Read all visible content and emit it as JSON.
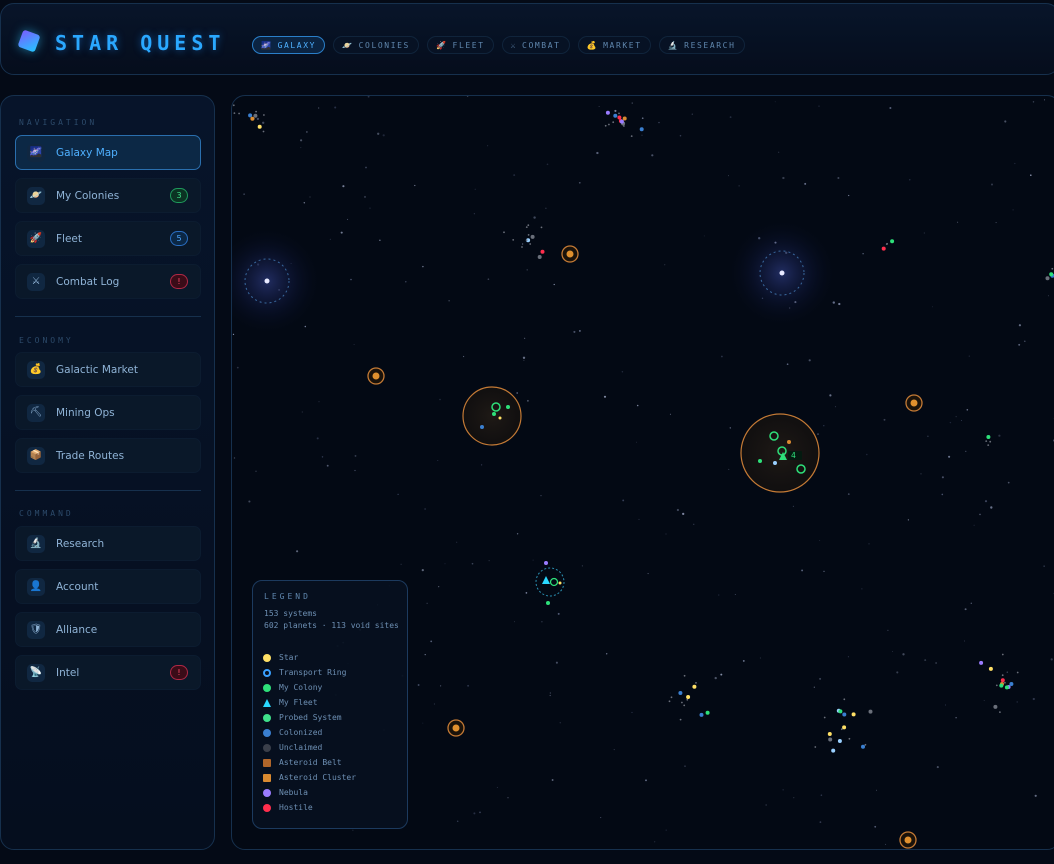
{
  "app": {
    "title": "STAR QUEST"
  },
  "tabs": [
    {
      "label": "GALAXY",
      "icon": "galaxy-icon",
      "glyph": "🌌",
      "active": true
    },
    {
      "label": "COLONIES",
      "icon": "planet-icon",
      "glyph": "🪐"
    },
    {
      "label": "FLEET",
      "icon": "rocket-icon",
      "glyph": "🚀"
    },
    {
      "label": "COMBAT",
      "icon": "crossed-swords-icon",
      "glyph": "⚔"
    },
    {
      "label": "MARKET",
      "icon": "money-bag-icon",
      "glyph": "💰"
    },
    {
      "label": "RESEARCH",
      "icon": "microscope-icon",
      "glyph": "🔬"
    }
  ],
  "sidebar": {
    "sections": [
      {
        "title": "NAVIGATION"
      },
      {
        "title": "ECONOMY"
      },
      {
        "title": "COMMAND"
      }
    ],
    "items": [
      {
        "label": "Galaxy Map",
        "icon": "galaxy-icon",
        "glyph": "🌌",
        "active": true
      },
      {
        "label": "My Colonies",
        "icon": "planet-icon",
        "glyph": "🪐",
        "badge": "3",
        "badge_color": "green"
      },
      {
        "label": "Fleet",
        "icon": "rocket-icon",
        "glyph": "🚀",
        "badge": "5",
        "badge_color": "blue"
      },
      {
        "label": "Combat Log",
        "icon": "crossed-swords-icon",
        "glyph": "⚔",
        "badge": "!",
        "badge_color": "red"
      },
      {
        "label": "Galactic Market",
        "icon": "money-bag-icon",
        "glyph": "💰"
      },
      {
        "label": "Mining Ops",
        "icon": "pickaxe-icon",
        "glyph": "⛏"
      },
      {
        "label": "Trade Routes",
        "icon": "package-icon",
        "glyph": "📦"
      },
      {
        "label": "Research",
        "icon": "microscope-icon",
        "glyph": "🔬"
      },
      {
        "label": "Account",
        "icon": "user-icon",
        "glyph": "👤"
      },
      {
        "label": "Alliance",
        "icon": "shield-icon",
        "glyph": "🛡"
      },
      {
        "label": "Intel",
        "icon": "satellite-icon",
        "glyph": "📡",
        "badge": "!",
        "badge_color": "red"
      }
    ]
  },
  "legend": {
    "title": "LEGEND",
    "systems": "153 systems",
    "planets": "602 planets · 113 void sites",
    "entries": [
      {
        "label": "Star",
        "shape": "circle",
        "color": "#ffe066"
      },
      {
        "label": "Transport Ring",
        "shape": "ring",
        "color": "#3aa0ff"
      },
      {
        "label": "My Colony",
        "shape": "circle",
        "color": "#2ee07a"
      },
      {
        "label": "My Fleet",
        "shape": "triangle",
        "color": "#2ad8ff"
      },
      {
        "label": "Probed System",
        "shape": "circle",
        "color": "#3fe08a"
      },
      {
        "label": "Colonized",
        "shape": "circle",
        "color": "#3a7fd0"
      },
      {
        "label": "Unclaimed",
        "shape": "circle",
        "color": "#3a3f4a"
      },
      {
        "label": "Asteroid Belt",
        "shape": "square",
        "color": "#b0662a"
      },
      {
        "label": "Asteroid Cluster",
        "shape": "square",
        "color": "#d98a30"
      },
      {
        "label": "Nebula",
        "shape": "circle",
        "color": "#9a7cff"
      },
      {
        "label": "Hostile",
        "shape": "circle",
        "color": "#ff2e4d"
      }
    ]
  },
  "map": {
    "fleet_count": "4"
  }
}
